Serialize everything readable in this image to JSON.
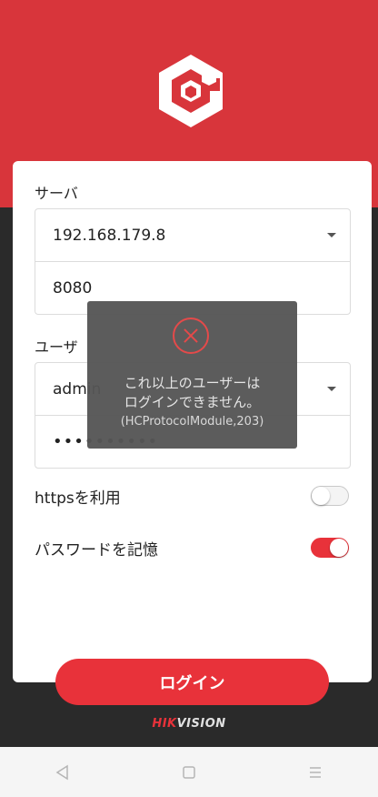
{
  "server_section": {
    "label": "サーバ",
    "address": "192.168.179.8",
    "port": "8080"
  },
  "user_section": {
    "label": "ユーザ",
    "username": "admin",
    "password_masked": "••••••••••"
  },
  "options": {
    "https_label": "httpsを利用",
    "https_enabled": false,
    "remember_label": "パスワードを記憶",
    "remember_enabled": true
  },
  "login_button": "ログイン",
  "brand": {
    "part1": "HIK",
    "part2": "VISION"
  },
  "toast": {
    "line1": "これ以上のユーザーは",
    "line2": "ログインできません。",
    "code": "(HCProtocolModule,203)"
  },
  "colors": {
    "accent": "#e8323a",
    "header": "#d8353b",
    "background": "#2a2a2a"
  },
  "icons": {
    "app_logo": "hexagon-cube-logo-icon",
    "toast": "error-x-circle-icon",
    "nav_back": "triangle-back-icon",
    "nav_home": "square-home-icon",
    "nav_menu": "hamburger-menu-icon"
  }
}
